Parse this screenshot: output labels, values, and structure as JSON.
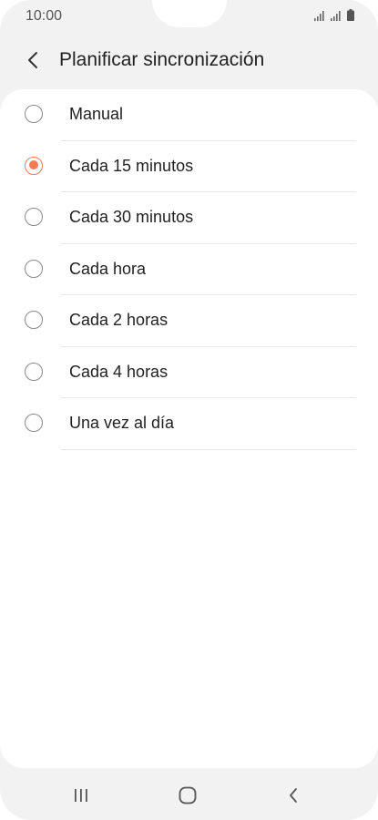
{
  "status_bar": {
    "time": "10:00"
  },
  "header": {
    "back_icon": "chevron-left-icon",
    "title": "Planificar sincronización"
  },
  "options": [
    {
      "label": "Manual",
      "selected": false
    },
    {
      "label": "Cada 15 minutos",
      "selected": true
    },
    {
      "label": "Cada 30 minutos",
      "selected": false
    },
    {
      "label": "Cada hora",
      "selected": false
    },
    {
      "label": "Cada 2 horas",
      "selected": false
    },
    {
      "label": "Cada 4 horas",
      "selected": false
    },
    {
      "label": "Una vez al día",
      "selected": false
    }
  ],
  "nav_bar": {
    "recents_icon": "recent-apps-icon",
    "home_icon": "home-icon",
    "back_icon": "back-icon"
  },
  "colors": {
    "accent": "#ef7c55",
    "background": "#f2f2f2",
    "card": "#ffffff",
    "text": "#222222"
  }
}
